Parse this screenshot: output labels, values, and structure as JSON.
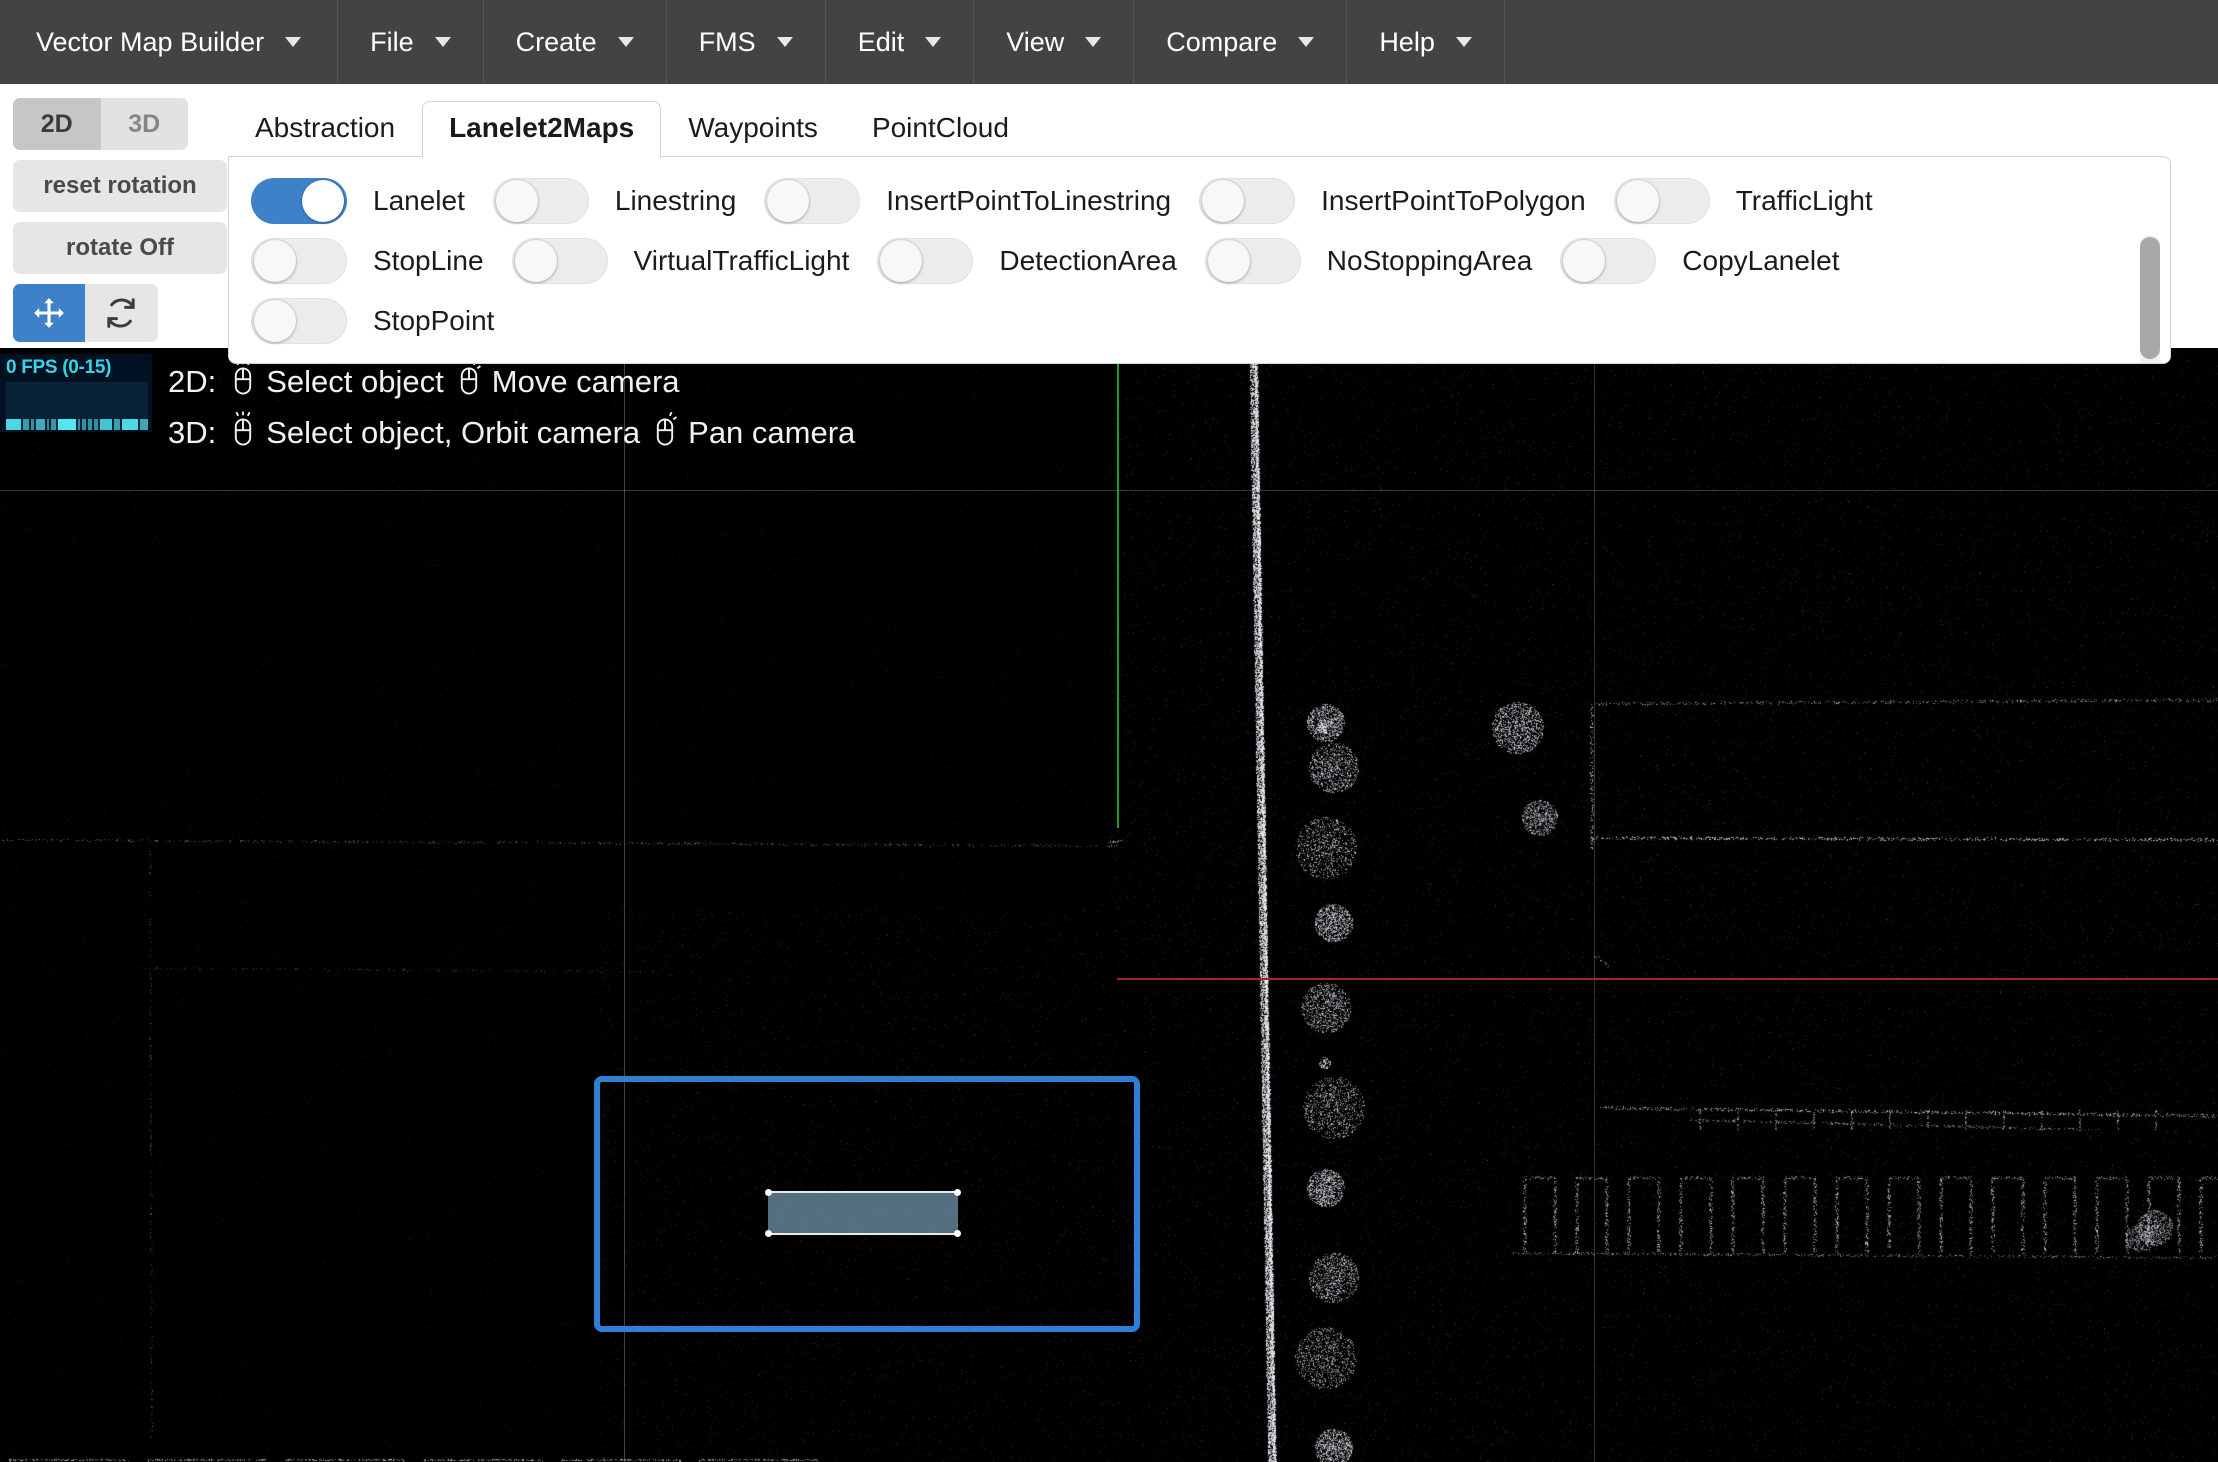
{
  "menubar": {
    "items": [
      {
        "label": "Vector Map Builder",
        "icon": "chevron-down-icon"
      },
      {
        "label": "File",
        "icon": "chevron-down-icon"
      },
      {
        "label": "Create",
        "icon": "chevron-down-icon"
      },
      {
        "label": "FMS",
        "icon": "chevron-down-icon"
      },
      {
        "label": "Edit",
        "icon": "chevron-down-icon"
      },
      {
        "label": "View",
        "icon": "chevron-down-icon"
      },
      {
        "label": "Compare",
        "icon": "chevron-down-icon"
      },
      {
        "label": "Help",
        "icon": "chevron-down-icon"
      }
    ]
  },
  "left_controls": {
    "view_mode": {
      "options": [
        "2D",
        "3D"
      ],
      "selected": "2D"
    },
    "reset_rotation_label": "reset rotation",
    "rotate_toggle_label": "rotate Off",
    "move_tool": {
      "icon": "move-arrows-icon",
      "active": true
    },
    "refresh_tool": {
      "icon": "refresh-icon",
      "active": false
    }
  },
  "tabs": {
    "items": [
      {
        "label": "Abstraction",
        "active": false
      },
      {
        "label": "Lanelet2Maps",
        "active": true
      },
      {
        "label": "Waypoints",
        "active": false
      },
      {
        "label": "PointCloud",
        "active": false
      }
    ]
  },
  "toggles": {
    "rows": [
      [
        {
          "label": "Lanelet",
          "on": true
        },
        {
          "label": "Linestring",
          "on": false
        },
        {
          "label": "InsertPointToLinestring",
          "on": false
        },
        {
          "label": "InsertPointToPolygon",
          "on": false
        },
        {
          "label": "TrafficLight",
          "on": false
        }
      ],
      [
        {
          "label": "StopLine",
          "on": false
        },
        {
          "label": "VirtualTrafficLight",
          "on": false
        },
        {
          "label": "DetectionArea",
          "on": false
        },
        {
          "label": "NoStoppingArea",
          "on": false
        },
        {
          "label": "CopyLanelet",
          "on": false
        }
      ],
      [
        {
          "label": "StopPoint",
          "on": false
        }
      ]
    ]
  },
  "viewport": {
    "fps": {
      "text": "0 FPS (0-15)",
      "bars": [
        22,
        8,
        5,
        12,
        3,
        7,
        26,
        4,
        5,
        6,
        5,
        18,
        9,
        23,
        11
      ]
    },
    "help": {
      "line1": {
        "prefix": "2D:",
        "action1": "Select object",
        "action2": "Move camera"
      },
      "line2": {
        "prefix": "3D:",
        "action1": "Select object, Orbit camera",
        "action2": "Pan camera"
      }
    },
    "selection": {
      "name": "selected-lanelet-bounds"
    },
    "lanelet": {
      "name": "lanelet-polygon"
    }
  },
  "colors": {
    "menubar_bg": "#434343",
    "accent_blue": "#3f81c9",
    "selection_blue": "#2f7fd4",
    "axis_green": "#1f9c27",
    "axis_red": "#a32520",
    "fps_cyan": "#33d6e8",
    "lanelet_fill": "#6c8ea4"
  }
}
